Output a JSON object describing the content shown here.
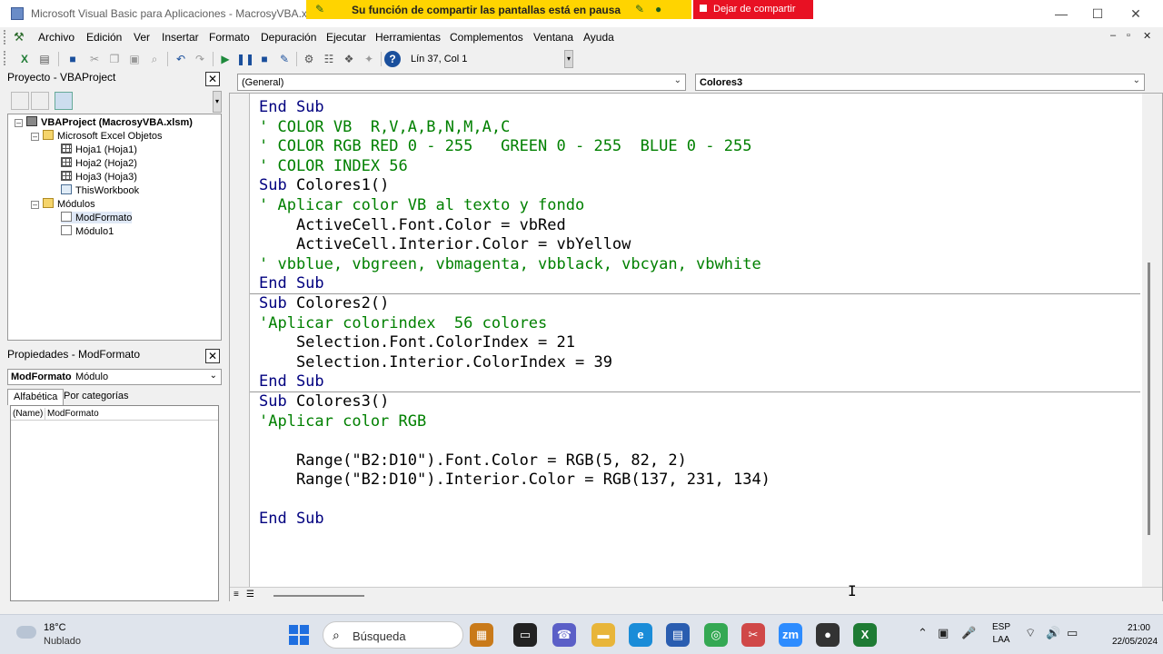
{
  "window": {
    "title": "Microsoft Visual Basic para Aplicaciones - MacrosyVBA.xlsm",
    "minimize": "—",
    "restore": "☐",
    "close": "✕"
  },
  "share_banner": {
    "message": "Su función de compartir las pantallas está en pausa",
    "stop_label": "Dejar de compartir"
  },
  "menu": {
    "items": [
      "Archivo",
      "Edición",
      "Ver",
      "Insertar",
      "Formato",
      "Depuración",
      "Ejecutar",
      "Herramientas",
      "Complementos",
      "Ventana",
      "Ayuda"
    ],
    "mdi": [
      "–",
      "▫",
      "✕"
    ]
  },
  "toolbar": {
    "position_status": "Lín 37, Col 1"
  },
  "project": {
    "title": "Proyecto - VBAProject",
    "close": "✕",
    "tree": {
      "root": "VBAProject (MacrosyVBA.xlsm)",
      "folder_objects": "Microsoft Excel Objetos",
      "sheets": [
        "Hoja1 (Hoja1)",
        "Hoja2 (Hoja2)",
        "Hoja3 (Hoja3)"
      ],
      "workbook": "ThisWorkbook",
      "folder_modules": "Módulos",
      "modules": [
        "ModFormato",
        "Módulo1"
      ]
    }
  },
  "properties": {
    "title": "Propiedades - ModFormato",
    "close": "✕",
    "object_name": "ModFormato",
    "object_type": "Módulo",
    "tabs": [
      "Alfabética",
      "Por categorías"
    ],
    "name_key": "(Name)",
    "name_value": "ModFormato"
  },
  "code": {
    "object_combo": "(General)",
    "proc_combo": "Colores3",
    "lines": [
      {
        "t": "kw",
        "text": "End Sub"
      },
      {
        "t": "cm",
        "text": "' COLOR VB  R,V,A,B,N,M,A,C"
      },
      {
        "t": "cm",
        "text": "' COLOR RGB RED 0 - 255   GREEN 0 - 255  BLUE 0 - 255"
      },
      {
        "t": "cm",
        "text": "' COLOR INDEX 56"
      },
      {
        "t": "mix",
        "kw": "Sub",
        "rest": " Colores1()"
      },
      {
        "t": "cm",
        "text": "' Aplicar color VB al texto y fondo"
      },
      {
        "t": "tx",
        "text": "    ActiveCell.Font.Color = vbRed"
      },
      {
        "t": "tx",
        "text": "    ActiveCell.Interior.Color = vbYellow"
      },
      {
        "t": "cm",
        "text": "' vbblue, vbgreen, vbmagenta, vbblack, vbcyan, vbwhite"
      },
      {
        "t": "kw",
        "text": "End Sub"
      },
      {
        "t": "mix",
        "kw": "Sub",
        "rest": " Colores2()"
      },
      {
        "t": "cm",
        "text": "'Aplicar colorindex  56 colores"
      },
      {
        "t": "tx",
        "text": "    Selection.Font.ColorIndex = 21"
      },
      {
        "t": "tx",
        "text": "    Selection.Interior.ColorIndex = 39"
      },
      {
        "t": "kw",
        "text": "End Sub"
      },
      {
        "t": "mix",
        "kw": "Sub",
        "rest": " Colores3()"
      },
      {
        "t": "cm",
        "text": "'Aplicar color RGB"
      },
      {
        "t": "tx",
        "text": ""
      },
      {
        "t": "tx",
        "text": "    Range(\"B2:D10\").Font.Color = RGB(5, 82, 2)"
      },
      {
        "t": "tx",
        "text": "    Range(\"B2:D10\").Interior.Color = RGB(137, 231, 134)"
      },
      {
        "t": "tx",
        "text": ""
      },
      {
        "t": "kw",
        "text": "End Sub"
      }
    ],
    "separators_after_line": [
      9,
      14
    ]
  },
  "taskbar": {
    "temperature": "18°C",
    "condition": "Nublado",
    "search_label": "Búsqueda",
    "lang_top": "ESP",
    "lang_bottom": "LAA",
    "time": "21:00",
    "date": "22/05/2024"
  },
  "colors": {
    "keyword": "#00007f",
    "comment": "#008000",
    "share_banner": "#ffd400",
    "stop_share": "#e81123"
  }
}
